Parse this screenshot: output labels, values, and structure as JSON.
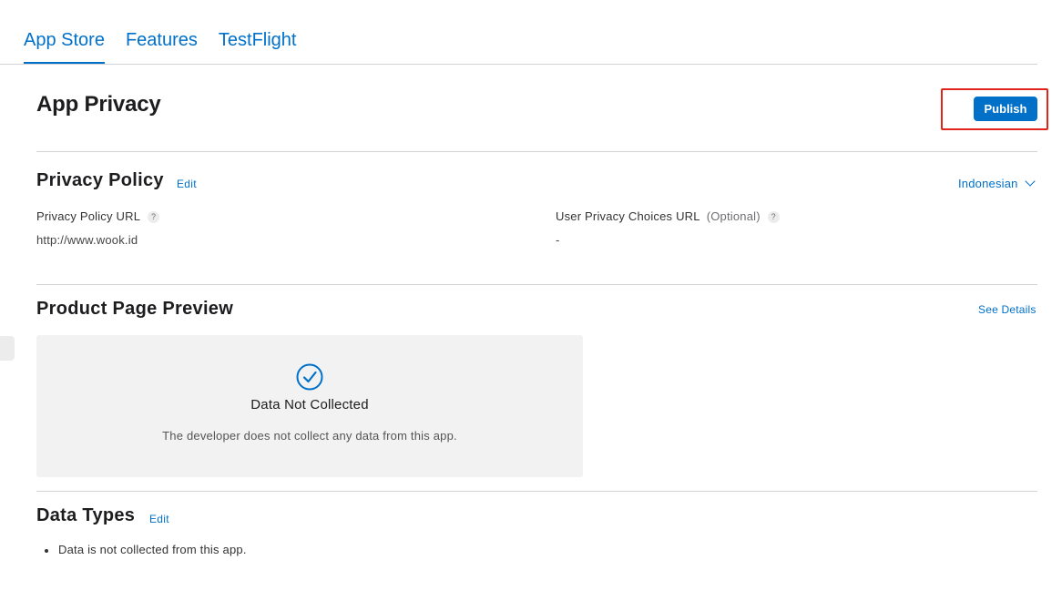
{
  "tabs": [
    {
      "label": "App Store",
      "active": true
    },
    {
      "label": "Features",
      "active": false
    },
    {
      "label": "TestFlight",
      "active": false
    }
  ],
  "page": {
    "title": "App Privacy",
    "publish_label": "Publish"
  },
  "privacy_policy": {
    "title": "Privacy Policy",
    "edit_label": "Edit",
    "language": "Indonesian",
    "url_label": "Privacy Policy URL",
    "url_value": "http://www.wook.id",
    "choices_label": "User Privacy Choices URL",
    "choices_optional": "(Optional)",
    "choices_value": "-",
    "help_glyph": "?"
  },
  "product_page_preview": {
    "title": "Product Page Preview",
    "see_details_label": "See Details",
    "card_title": "Data Not Collected",
    "card_description": "The developer does not collect any data from this app."
  },
  "data_types": {
    "title": "Data Types",
    "edit_label": "Edit",
    "items": [
      "Data is not collected from this app."
    ]
  },
  "colors": {
    "accent": "#0070c9",
    "highlight_frame": "#e0251b",
    "card_background": "#f2f2f2"
  }
}
